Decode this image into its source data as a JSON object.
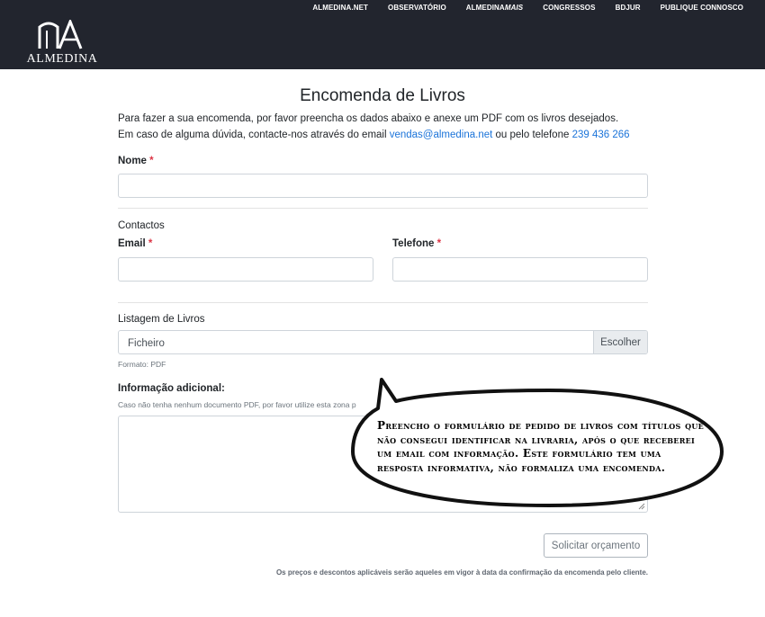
{
  "header": {
    "logo_text": "ALMEDINA",
    "nav": [
      {
        "label": "ALMEDINA.NET"
      },
      {
        "label": "OBSERVATÓRIO"
      },
      {
        "label_main": "ALMEDINA",
        "label_italic": "MAIS"
      },
      {
        "label": "CONGRESSOS"
      },
      {
        "label": "BDJUR"
      },
      {
        "label": "PUBLIQUE CONNOSCO"
      }
    ]
  },
  "form": {
    "title": "Encomenda de Livros",
    "intro_line1": "Para fazer a sua encomenda, por favor preencha os dados abaixo e anexe um PDF com os livros desejados.",
    "intro_line2_prefix": "Em caso de alguma dúvida, contacte-nos através do email ",
    "email_link": "vendas@almedina.net",
    "intro_line2_middle": " ou pelo telefone ",
    "phone_link": "239 436 266",
    "required_marker": "*",
    "name_label": "Nome",
    "contacts_heading": "Contactos",
    "email_label": "Email",
    "phone_label": "Telefone",
    "list_heading": "Listagem de Livros",
    "file_placeholder": "Ficheiro",
    "file_button": "Escolher",
    "file_hint": "Formato: PDF",
    "extra_label": "Informação adicional:",
    "extra_hint": "Caso não tenha nenhum documento PDF, por favor utilize esta zona p",
    "submit_label": "Solicitar orçamento",
    "footnote": "Os preços e descontos aplicáveis serão aqueles em vigor à data da confirmação da encomenda pelo cliente."
  },
  "bubble": {
    "text": "Preencho o formulário de pedido de livros com títulos que não consegui identificar na livraria, após o que receberei um email com informação. Este formulário tem uma resposta informativa, não formaliza uma encomenda."
  }
}
